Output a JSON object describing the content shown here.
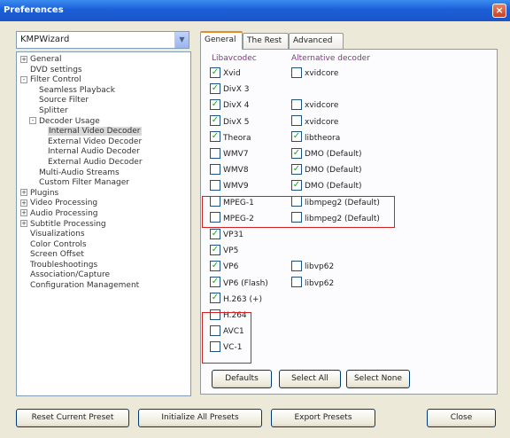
{
  "window": {
    "title": "Preferences"
  },
  "preset": {
    "selected": "KMPWizard"
  },
  "tree": [
    {
      "label": "General",
      "level": 0,
      "toggle": "+"
    },
    {
      "label": "DVD settings",
      "level": 0,
      "toggle": ""
    },
    {
      "label": "Filter Control",
      "level": 0,
      "toggle": "-"
    },
    {
      "label": "Seamless Playback",
      "level": 1,
      "toggle": ""
    },
    {
      "label": "Source Filter",
      "level": 1,
      "toggle": ""
    },
    {
      "label": "Splitter",
      "level": 1,
      "toggle": ""
    },
    {
      "label": "Decoder Usage",
      "level": 1,
      "toggle": "-"
    },
    {
      "label": "Internal Video Decoder",
      "level": 2,
      "toggle": "",
      "selected": true
    },
    {
      "label": "External Video Decoder",
      "level": 2,
      "toggle": ""
    },
    {
      "label": "Internal Audio Decoder",
      "level": 2,
      "toggle": ""
    },
    {
      "label": "External Audio Decoder",
      "level": 2,
      "toggle": ""
    },
    {
      "label": "Multi-Audio Streams",
      "level": 1,
      "toggle": ""
    },
    {
      "label": "Custom Filter Manager",
      "level": 1,
      "toggle": ""
    },
    {
      "label": "Plugins",
      "level": 0,
      "toggle": "+"
    },
    {
      "label": "Video Processing",
      "level": 0,
      "toggle": "+"
    },
    {
      "label": "Audio Processing",
      "level": 0,
      "toggle": "+"
    },
    {
      "label": "Subtitle Processing",
      "level": 0,
      "toggle": "+"
    },
    {
      "label": "Visualizations",
      "level": 0,
      "toggle": ""
    },
    {
      "label": "Color Controls",
      "level": 0,
      "toggle": ""
    },
    {
      "label": "Screen Offset",
      "level": 0,
      "toggle": ""
    },
    {
      "label": "Troubleshootings",
      "level": 0,
      "toggle": ""
    },
    {
      "label": "Association/Capture",
      "level": 0,
      "toggle": ""
    },
    {
      "label": "Configuration Management",
      "level": 0,
      "toggle": ""
    }
  ],
  "tabs": [
    {
      "label": "General",
      "active": true
    },
    {
      "label": "The Rest",
      "active": false
    },
    {
      "label": "Advanced",
      "active": false
    }
  ],
  "columns": {
    "libavcodec": "Libavcodec",
    "alternative": "Alternative decoder"
  },
  "codecs": [
    {
      "label": "Xvid",
      "checked": true,
      "alt_label": "xvidcore",
      "alt_checked": false
    },
    {
      "label": "DivX 3",
      "checked": true,
      "alt_label": null,
      "alt_checked": false
    },
    {
      "label": "DivX 4",
      "checked": true,
      "alt_label": "xvidcore",
      "alt_checked": false
    },
    {
      "label": "DivX 5",
      "checked": true,
      "alt_label": "xvidcore",
      "alt_checked": false
    },
    {
      "label": "Theora",
      "checked": true,
      "alt_label": "libtheora",
      "alt_checked": true
    },
    {
      "label": "WMV7",
      "checked": false,
      "alt_label": "DMO (Default)",
      "alt_checked": true
    },
    {
      "label": "WMV8",
      "checked": false,
      "alt_label": "DMO (Default)",
      "alt_checked": true
    },
    {
      "label": "WMV9",
      "checked": false,
      "alt_label": "DMO (Default)",
      "alt_checked": true
    },
    {
      "label": "MPEG-1",
      "checked": false,
      "alt_label": "libmpeg2 (Default)",
      "alt_checked": false
    },
    {
      "label": "MPEG-2",
      "checked": false,
      "alt_label": "libmpeg2 (Default)",
      "alt_checked": false
    },
    {
      "label": "VP31",
      "checked": true,
      "alt_label": null,
      "alt_checked": false
    },
    {
      "label": "VP5",
      "checked": true,
      "alt_label": null,
      "alt_checked": false
    },
    {
      "label": "VP6",
      "checked": true,
      "alt_label": "libvp62",
      "alt_checked": false
    },
    {
      "label": "VP6 (Flash)",
      "checked": true,
      "alt_label": "libvp62",
      "alt_checked": false
    },
    {
      "label": "H.263 (+)",
      "checked": true,
      "alt_label": null,
      "alt_checked": false
    },
    {
      "label": "H.264",
      "checked": false,
      "alt_label": null,
      "alt_checked": false
    },
    {
      "label": "AVC1",
      "checked": false,
      "alt_label": null,
      "alt_checked": false
    },
    {
      "label": "VC-1",
      "checked": false,
      "alt_label": null,
      "alt_checked": false
    }
  ],
  "panel_buttons": {
    "defaults": "Defaults",
    "select_all": "Select All",
    "select_none": "Select None"
  },
  "footer": {
    "reset": "Reset Current Preset",
    "initialize": "Initialize All Presets",
    "export": "Export Presets",
    "close": "Close"
  },
  "colors": {
    "highlight": "#d42020",
    "check": "#21a121",
    "column_header": "#7e3b7e"
  }
}
